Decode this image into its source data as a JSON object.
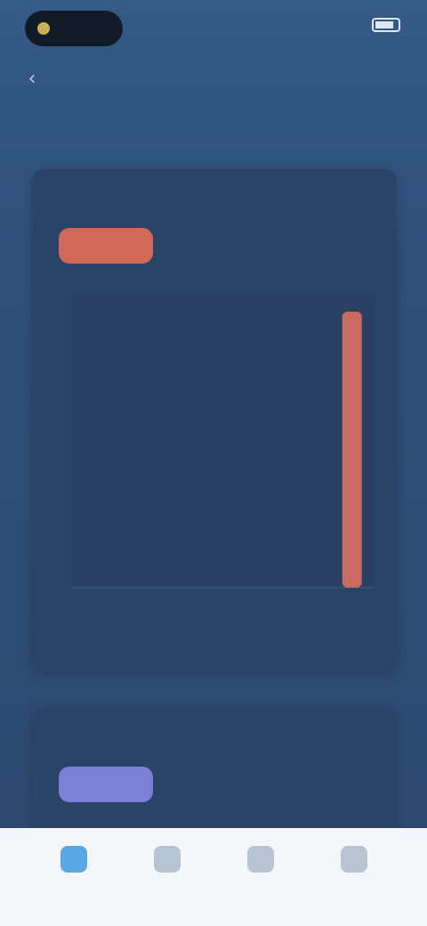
{
  "status": {
    "time": "",
    "battery_label": ""
  },
  "header": {
    "title": "",
    "right_text": ""
  },
  "page_title": "",
  "cards": [
    {
      "title": "",
      "tabs": [
        "",
        "",
        ""
      ],
      "active_tab": 0,
      "accent": "#d0695a"
    },
    {
      "title": "",
      "tabs": [
        "",
        "",
        ""
      ],
      "active_tab": 0,
      "accent": "#7e7fd6"
    }
  ],
  "chart_data": {
    "type": "bar",
    "categories": [
      "",
      "",
      "",
      "",
      "",
      "",
      ""
    ],
    "values": [
      0,
      0,
      0,
      0,
      0,
      0,
      1
    ],
    "ylim": [
      0,
      1
    ],
    "xlabel": "",
    "ylabel": "",
    "title": "",
    "bar_color": "#c86b63",
    "grid": false
  },
  "bottom_nav": {
    "items": [
      {
        "label": "",
        "icon": "home-icon"
      },
      {
        "label": "",
        "icon": "chart-icon"
      },
      {
        "label": "",
        "icon": "calendar-icon"
      },
      {
        "label": "",
        "icon": "profile-icon"
      }
    ],
    "active_index": 0
  }
}
